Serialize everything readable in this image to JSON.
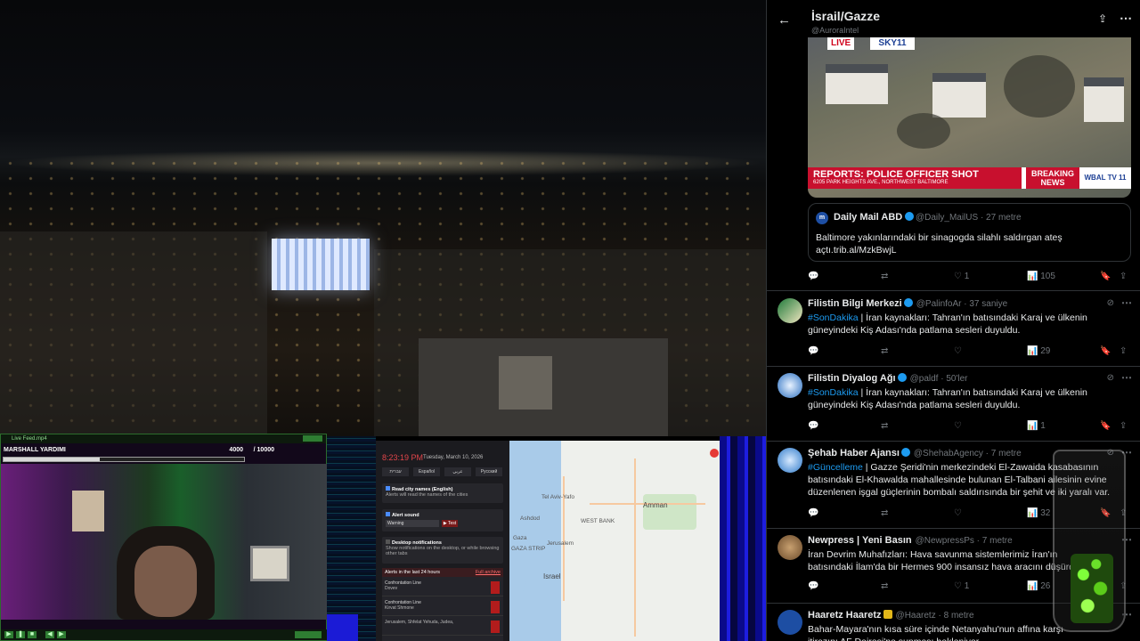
{
  "webcam": {
    "window_title": "Live Feed.mp4",
    "player_name": "MARSHALL YARDIMI",
    "xp_current": "4000",
    "xp_max": "/ 10000",
    "xp_fraction": 0.4
  },
  "alerts": {
    "time": "8:23:19 PM",
    "date": "Tuesday, March 10, 2026",
    "languages": [
      "עברית",
      "Español",
      "عربي",
      "Русский"
    ],
    "read_city_names": {
      "label": "Read city names (English)",
      "desc": "Alerts will read the names of the cities"
    },
    "alert_sound": {
      "label": "Alert sound",
      "value": "Warning",
      "test": "▶ Test"
    },
    "desktop_notifications": {
      "label": "Desktop notifications",
      "desc": "Show notifications on the desktop, or while browsing other tabs"
    },
    "list_title": "Alerts in the last 24 hours",
    "full_archive": "Full archive",
    "rows": [
      {
        "type": "Confrontation Line",
        "city": "Dovev"
      },
      {
        "type": "Confrontation Line",
        "city": "Kirvat Shmone"
      },
      {
        "type": "",
        "city": "Jerusalem, Shfelat Yehuda, Judea,"
      }
    ]
  },
  "map": {
    "labels": [
      "Tel Aviv-Yafo",
      "Amman",
      "Ashdod",
      "Jerusalem",
      "WEST BANK",
      "Gaza",
      "GAZA STRIP",
      "Israel"
    ]
  },
  "twitter": {
    "title": "İsrail/Gazze",
    "handle": "@AuroraIntel",
    "media": {
      "live": "LIVE",
      "channel": "SKY11",
      "headline": "REPORTS: POLICE OFFICER SHOT",
      "subline": "6205 PARK HEIGHTS AVE., NORTHWEST BALTIMORE",
      "breaking": "BREAKING NEWS",
      "station": "WBAL TV 11"
    },
    "quote": {
      "name": "Daily Mail ABD",
      "meta": "@Daily_MailUS · 27 metre",
      "text": "Baltimore yakınlarındaki bir sinagogda silahlı saldırgan ateş açtı.trib.al/MzkBwjL"
    },
    "quote_actions": {
      "likes": "1",
      "views": "105"
    },
    "posts": [
      {
        "name": "Filistin Bilgi Merkezi",
        "meta": "@PalinfoAr · 37 saniye",
        "tag": "#SonDakika",
        "text": " | İran kaynakları: Tahran'ın batısındaki Karaj ve ülkenin güneyindeki Kiş Adası'nda patlama sesleri duyuldu.",
        "views": "29",
        "likes": "",
        "retweets": ""
      },
      {
        "name": "Filistin Diyalog Ağı",
        "meta": "@paldf · 50'ler",
        "tag": "#SonDakika",
        "text": " | İran kaynakları: Tahran'ın batısındaki Karaj ve ülkenin güneyindeki Kiş Adası'nda patlama sesleri duyuldu.",
        "views": "1",
        "likes": "",
        "retweets": ""
      },
      {
        "name": "Şehab Haber Ajansı",
        "meta": "@ShehabAgency · 7 metre",
        "tag": "#Güncelleme",
        "text": " | Gazze Şeridi'nin merkezindeki El-Zawaida kasabasının batısındaki El-Khawalda mahallesinde bulunan El-Talbani ailesinin evine düzenlenen işgal güçlerinin bombalı saldırısında bir şehit ve iki yaralı var.",
        "views": "32",
        "likes": "",
        "retweets": ""
      },
      {
        "name": "Newpress | Yeni Basın",
        "meta": "@NewpressPs · 7 metre",
        "tag": "",
        "text": "İran Devrim Muhafızları: Hava savunma sistemlerimiz İran'ın batısındaki İlam'da bir Hermes 900 insansız hava aracını düşürdü.",
        "views": "26",
        "likes": "1",
        "retweets": ""
      },
      {
        "name": "Haaretz Haaretz",
        "meta": "@Haaretz · 8 metre",
        "tag": "",
        "text": "Bahar-Mayara'nın kısa süre içinde Netanyahu'nun affına karşı itirazını AF Dairesi'ne sunması bekleniyor",
        "views": "",
        "likes": "",
        "retweets": ""
      }
    ]
  },
  "colors": {
    "accent": "#1d9bf0",
    "bg": "#000000",
    "alert_red": "#e2454a"
  }
}
